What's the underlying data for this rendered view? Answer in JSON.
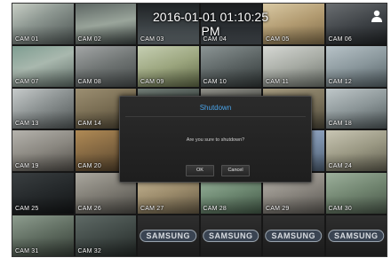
{
  "screen": {
    "datetime": "2016-01-01 01:10:25 PM"
  },
  "cameras": [
    {
      "label": "CAM 01"
    },
    {
      "label": "CAM 02"
    },
    {
      "label": "CAM 03"
    },
    {
      "label": "CAM 04"
    },
    {
      "label": "CAM 05"
    },
    {
      "label": "CAM 06"
    },
    {
      "label": "CAM 07"
    },
    {
      "label": "CAM 08"
    },
    {
      "label": "CAM 09"
    },
    {
      "label": "CAM 10"
    },
    {
      "label": "CAM 11"
    },
    {
      "label": "CAM 12"
    },
    {
      "label": "CAM 13"
    },
    {
      "label": "CAM 14"
    },
    {
      "label": ""
    },
    {
      "label": ""
    },
    {
      "label": ""
    },
    {
      "label": "CAM 18"
    },
    {
      "label": "CAM 19"
    },
    {
      "label": "CAM 20"
    },
    {
      "label": ""
    },
    {
      "label": ""
    },
    {
      "label": ""
    },
    {
      "label": "CAM 24"
    },
    {
      "label": "CAM 25"
    },
    {
      "label": "CAM 26"
    },
    {
      "label": "CAM 27"
    },
    {
      "label": "CAM 28"
    },
    {
      "label": "CAM 29"
    },
    {
      "label": "CAM 30"
    },
    {
      "label": "CAM 31"
    },
    {
      "label": "CAM 32"
    }
  ],
  "placeholder_brand": "SAMSUNG",
  "dialog": {
    "title": "Shutdown",
    "message": "Are you sure to shutdown?",
    "ok_label": "OK",
    "cancel_label": "Cancel"
  },
  "colors": {
    "dialog_title": "#4aa3e8",
    "background": "#111111"
  },
  "icons": {
    "user": "user-icon"
  }
}
